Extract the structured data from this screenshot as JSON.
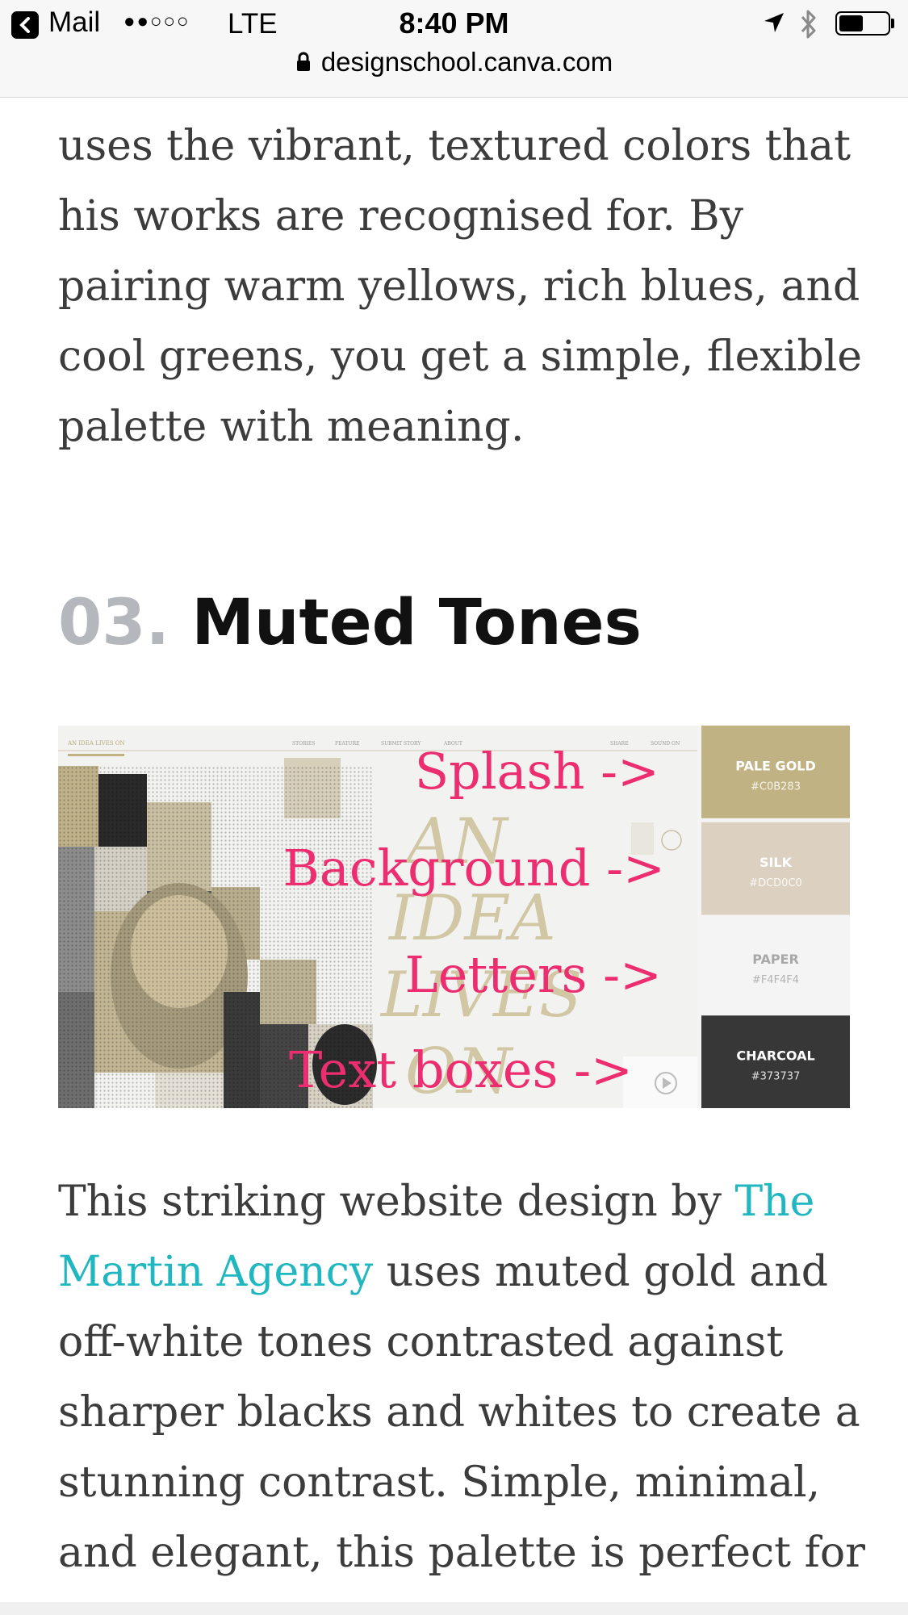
{
  "status_bar": {
    "back_app": "Mail",
    "signal": "●●○○○",
    "carrier": "LTE",
    "time": "8:40 PM",
    "battery_level": 0.5
  },
  "address_bar": {
    "url": "designschool.canva.com"
  },
  "article": {
    "paragraph_above": "uses the vibrant, textured colors that his works are recognised for. By pairing warm yellows, rich blues, and cool greens, you get a simple, flexible palette with meaning.",
    "section_number": "03.",
    "section_title": "Muted Tones",
    "figure": {
      "site_nav": [
        "STORIES",
        "FEATURE",
        "SUBMIT STORY",
        "ABOUT",
        "SHARE",
        "SOUND ON"
      ],
      "site_logo": "AN IDEA LIVES ON",
      "hero_lines": [
        "AN",
        "IDEA",
        "LIVES",
        "ON"
      ],
      "annotations": [
        "Splash ->",
        "Background ->",
        "Letters ->",
        "Text boxes ->"
      ],
      "swatches": [
        {
          "name": "PALE GOLD",
          "hex": "#C0B283",
          "color": "#c0b283",
          "text_color": "#ffffff"
        },
        {
          "name": "SILK",
          "hex": "#DCD0C0",
          "color": "#dcd0c0",
          "text_color": "#ffffff"
        },
        {
          "name": "PAPER",
          "hex": "#F4F4F4",
          "color": "#f4f4f4",
          "text_color": "#a8a8a8"
        },
        {
          "name": "CHARCOAL",
          "hex": "#373737",
          "color": "#373737",
          "text_color": "#ffffff"
        }
      ]
    },
    "paragraph_below": {
      "before_link": "This striking website design by ",
      "link_text": "The Martin Agency",
      "after_link": " uses muted gold and off-white tones contrasted against sharper blacks and whites to create a stunning contrast. Simple, minimal, and elegant, this palette is perfect for"
    }
  }
}
